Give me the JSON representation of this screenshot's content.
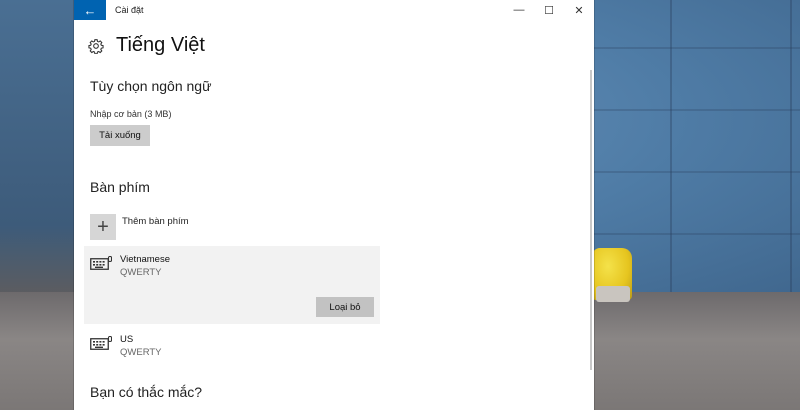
{
  "window": {
    "title": "Cài đặt",
    "back_icon": "←",
    "controls": {
      "minimize": "—",
      "maximize": "☐",
      "close": "✕"
    }
  },
  "page": {
    "title": "Tiếng Việt",
    "icon": "gear-icon"
  },
  "language_options": {
    "heading": "Tùy chọn ngôn ngữ",
    "basic_input_label": "Nhập cơ bản (3 MB)",
    "download_button": "Tải xuống"
  },
  "keyboards": {
    "heading": "Bàn phím",
    "add_label": "Thêm bàn phím",
    "add_icon": "+",
    "items": [
      {
        "name": "Vietnamese",
        "layout": "QWERTY",
        "remove_button": "Loại bỏ",
        "selected": true
      },
      {
        "name": "US",
        "layout": "QWERTY",
        "selected": false
      }
    ]
  },
  "faq": {
    "heading": "Bạn có thắc mắc?"
  },
  "colors": {
    "accent": "#0063b1",
    "button_gray": "#cccccc",
    "selected_bg": "#f2f2f2"
  }
}
